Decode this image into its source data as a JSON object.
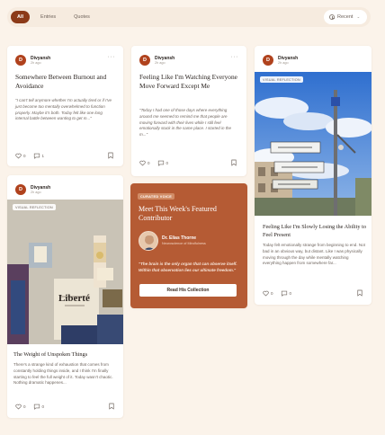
{
  "filters": {
    "tabs": [
      "All",
      "Entries",
      "Quotes"
    ],
    "active": "All",
    "sort_label": "Recent"
  },
  "colors": {
    "accent": "#8c3a18",
    "featured_bg": "#b55b34",
    "background": "#fbf3ea"
  },
  "cards": {
    "c1": {
      "author": "Divyansh",
      "avatar_initial": "D",
      "time": "2h ago",
      "title": "Somewhere Between Burnout and Avoidance",
      "quote": "\"I can't tell anymore whether I'm actually tired or if I've just become too mentally overwhelmed to function properly. Maybe it's both. Today felt like one long internal battle between wanting to get m...\"",
      "likes": "0",
      "comments": "1"
    },
    "c2": {
      "author": "Divyansh",
      "avatar_initial": "D",
      "time": "2h ago",
      "title": "Feeling Like I'm Watching Everyone Move Forward Except Me",
      "quote": "\"Today I had one of those days where everything around me seemed to remind me that people are moving forward with their lives while I still feel emotionally stuck in the same place. I started in the m...\"",
      "likes": "0",
      "comments": "0"
    },
    "c3": {
      "author": "Divyansh",
      "avatar_initial": "D",
      "time": "2h ago",
      "badge": "VISUAL REFLECTION",
      "title": "Feeling Like I'm Slowly Losing the Ability to Feel Present",
      "body": "Today felt emotionally strange from beginning to end. Not bad in an obvious way, but distant. Like I was physically moving through the day while mentally watching everything happen from somewhere far...",
      "likes": "0",
      "comments": "0"
    },
    "c4": {
      "author": "Divyansh",
      "avatar_initial": "D",
      "time": "2h ago",
      "badge": "VISUAL REFLECTION",
      "image_caption": "Liberté",
      "title": "The Weight of Unspoken Things",
      "body": "There's a strange kind of exhaustion that comes from constantly holding things inside, and I think I'm finally starting to feel the full weight of it. Today wasn't chaotic. Nothing dramatic happenes...",
      "likes": "0",
      "comments": "0"
    },
    "featured": {
      "badge": "CURATED VOICE",
      "title": "Meet This Week's Featured Contributor",
      "name": "Dr. Elias Thorne",
      "role": "Neuroscience of Mindfulness",
      "quote": "\"The brain is the only organ that can observe itself. Within that observation lies our ultimate freedom.\"",
      "button": "Read His Collection"
    }
  }
}
